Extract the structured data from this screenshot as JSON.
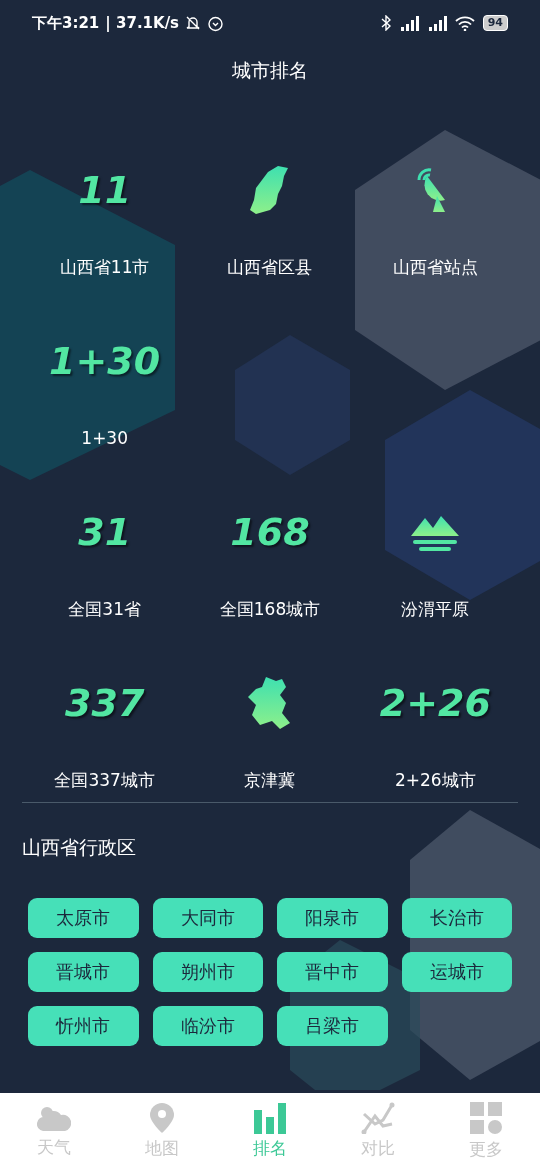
{
  "status_bar": {
    "time": "下午3:21",
    "speed": "| 37.1K/s",
    "battery": "94"
  },
  "title": "城市排名",
  "ranking_rows": [
    [
      {
        "kind": "number",
        "glyph": "11",
        "label": "山西省11市"
      },
      {
        "kind": "province",
        "label": "山西省区县"
      },
      {
        "kind": "dish",
        "label": "山西省站点"
      }
    ],
    [
      {
        "kind": "number",
        "glyph": "1+30",
        "label": "1+30"
      }
    ],
    [
      {
        "kind": "number",
        "glyph": "31",
        "label": "全国31省"
      },
      {
        "kind": "number",
        "glyph": "168",
        "label": "全国168城市"
      },
      {
        "kind": "mountains",
        "label": "汾渭平原"
      }
    ],
    [
      {
        "kind": "number",
        "glyph": "337",
        "label": "全国337城市"
      },
      {
        "kind": "region",
        "label": "京津冀"
      },
      {
        "kind": "number",
        "glyph": "2+26",
        "label": "2+26城市"
      }
    ]
  ],
  "section_title": "山西省行政区",
  "cities": [
    "太原市",
    "大同市",
    "阳泉市",
    "长治市",
    "晋城市",
    "朔州市",
    "晋中市",
    "运城市",
    "忻州市",
    "临汾市",
    "吕梁市"
  ],
  "nav": [
    {
      "kind": "weather",
      "label": "天气",
      "selected": false
    },
    {
      "kind": "map",
      "label": "地图",
      "selected": false
    },
    {
      "kind": "rank",
      "label": "排名",
      "selected": true
    },
    {
      "kind": "compare",
      "label": "对比",
      "selected": false
    },
    {
      "kind": "more",
      "label": "更多",
      "selected": false
    }
  ]
}
